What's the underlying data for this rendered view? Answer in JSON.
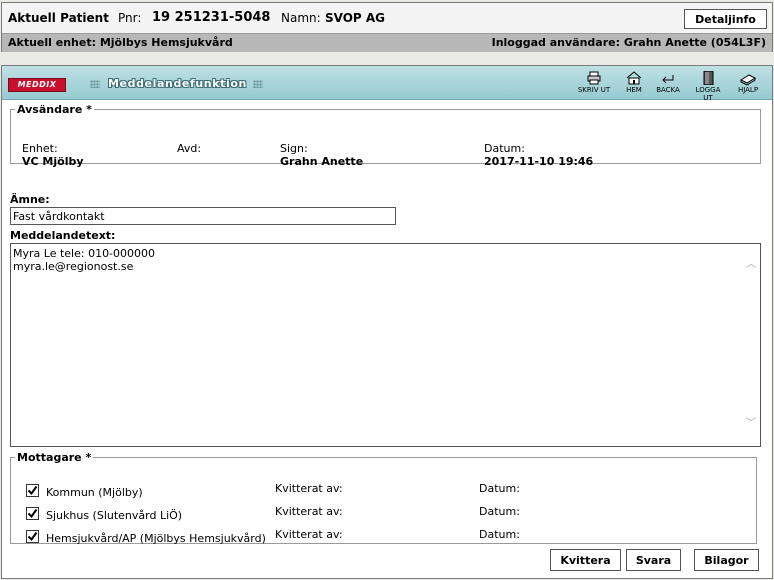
{
  "patient_header": {
    "current_patient_label": "Aktuell Patient",
    "pnr_label": "Pnr:",
    "pnr_value": "19 251231-5048",
    "name_label": "Namn:",
    "name_value": "SVOP AG",
    "details_button": "Detaljinfo",
    "unit_text": "Aktuell enhet: Mjölbys Hemsjukvård",
    "user_text": "Inloggad användare: Grahn Anette (054L3F)"
  },
  "app_bar": {
    "logo_text": "MEDDIX",
    "title": "Meddelandefunktion",
    "tools": [
      {
        "label": "SKRIV UT",
        "icon": "printer-icon"
      },
      {
        "label": "HEM",
        "icon": "home-icon"
      },
      {
        "label": "BACKA",
        "icon": "back-arrow-icon"
      },
      {
        "label": "LOGGA UT",
        "icon": "logout-door-icon"
      },
      {
        "label": "HJÄLP",
        "icon": "help-book-icon"
      }
    ]
  },
  "sender": {
    "legend": "Avsändare",
    "required_mark": "*",
    "unit_label": "Enhet:",
    "unit_value": "VC Mjölby",
    "avd_label": "Avd:",
    "sign_label": "Sign:",
    "sign_value": "Grahn Anette",
    "date_label": "Datum:",
    "date_value": "2017-11-10 19:46"
  },
  "subject": {
    "label": "Ämne:",
    "value": "Fast vårdkontakt"
  },
  "message": {
    "label": "Meddelandetext:",
    "text": "Myra Le tele: 010-000000\nmyra.le@regionost.se"
  },
  "recipients": {
    "legend": "Mottagare",
    "required_mark": "*",
    "rows": [
      {
        "name": "Kommun (Mjölby)",
        "checked": true,
        "ack_label": "Kvitterat av:",
        "date_label": "Datum:"
      },
      {
        "name": "Sjukhus (Slutenvård LiÖ)",
        "checked": true,
        "ack_label": "Kvitterat av:",
        "date_label": "Datum:"
      },
      {
        "name": "Hemsjukvård/AP (Mjölbys Hemsjukvård)",
        "checked": true,
        "ack_label": "Kvitterat av:",
        "date_label": "Datum:"
      }
    ]
  },
  "actions": {
    "acknowledge": "Kvittera",
    "reply": "Svara",
    "attachments": "Bilagor"
  }
}
